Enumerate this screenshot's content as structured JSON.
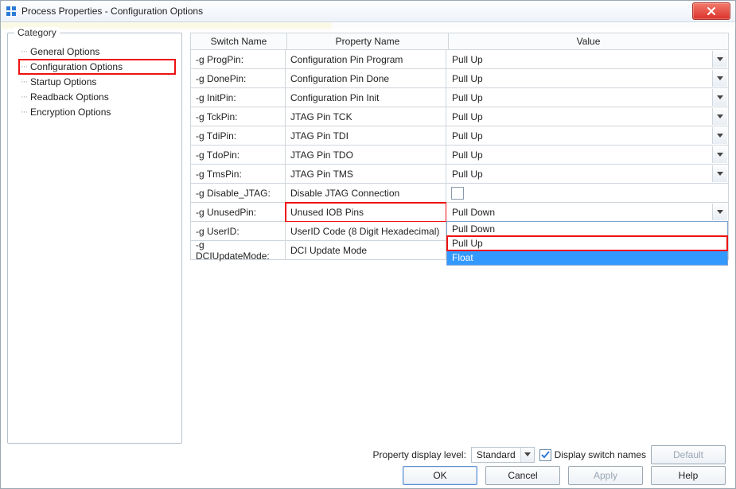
{
  "title": "Process Properties - Configuration Options",
  "category_label": "Category",
  "categories": [
    {
      "label": "General Options",
      "highlight": false
    },
    {
      "label": "Configuration Options",
      "highlight": true
    },
    {
      "label": "Startup Options",
      "highlight": false
    },
    {
      "label": "Readback Options",
      "highlight": false
    },
    {
      "label": "Encryption Options",
      "highlight": false
    }
  ],
  "columns": {
    "switch": "Switch Name",
    "prop": "Property Name",
    "value": "Value"
  },
  "rows": [
    {
      "switch": "-g ProgPin:",
      "prop": "Configuration Pin Program",
      "value": "Pull Up",
      "type": "combo"
    },
    {
      "switch": "-g DonePin:",
      "prop": "Configuration Pin Done",
      "value": "Pull Up",
      "type": "combo"
    },
    {
      "switch": "-g InitPin:",
      "prop": "Configuration Pin Init",
      "value": "Pull Up",
      "type": "combo"
    },
    {
      "switch": "-g TckPin:",
      "prop": "JTAG Pin TCK",
      "value": "Pull Up",
      "type": "combo"
    },
    {
      "switch": "-g TdiPin:",
      "prop": "JTAG Pin TDI",
      "value": "Pull Up",
      "type": "combo"
    },
    {
      "switch": "-g TdoPin:",
      "prop": "JTAG Pin TDO",
      "value": "Pull Up",
      "type": "combo"
    },
    {
      "switch": "-g TmsPin:",
      "prop": "JTAG Pin TMS",
      "value": "Pull Up",
      "type": "combo"
    },
    {
      "switch": "-g Disable_JTAG:",
      "prop": "Disable JTAG Connection",
      "value": "",
      "type": "check"
    },
    {
      "switch": "-g UnusedPin:",
      "prop": "Unused IOB Pins",
      "value": "Pull Down",
      "type": "combo",
      "prop_hl": true,
      "open": true,
      "options": [
        {
          "label": "Pull Down",
          "hl": false,
          "sel": false
        },
        {
          "label": "Pull Up",
          "hl": true,
          "sel": false
        },
        {
          "label": "Float",
          "hl": false,
          "sel": true
        }
      ]
    },
    {
      "switch": "-g UserID:",
      "prop": "UserID Code (8 Digit Hexadecimal)",
      "value": "",
      "type": "text"
    },
    {
      "switch": "-g DCIUpdateMode:",
      "prop": "DCI Update Mode",
      "value": "",
      "type": "text"
    }
  ],
  "footer": {
    "level_label": "Property display level:",
    "level_value": "Standard",
    "switch_names_label": "Display switch names",
    "default_label": "Default",
    "ok": "OK",
    "cancel": "Cancel",
    "apply": "Apply",
    "help": "Help"
  }
}
